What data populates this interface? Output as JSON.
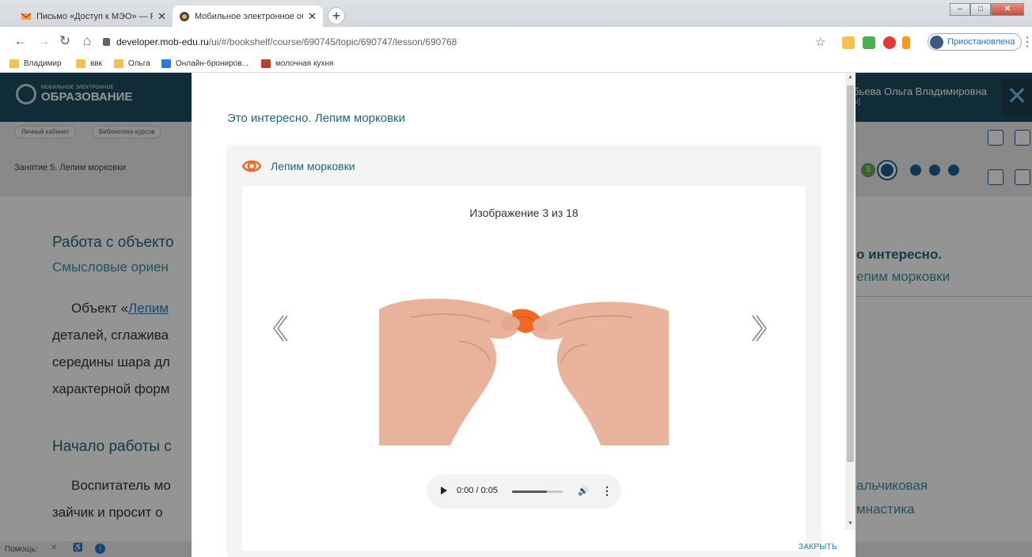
{
  "browser": {
    "tabs": [
      {
        "title": "Письмо «Доступ к МЭО» — Ро",
        "active": false
      },
      {
        "title": "Мобильное электронное обра",
        "active": true
      }
    ],
    "url_host": "developer.mob-edu.ru",
    "url_path": "/ui/#/bookshelf/course/690745/topic/690747/lesson/690768",
    "profile_label": "Приостановлена",
    "bookmarks": [
      "Владимир",
      "ввк",
      "Ольга",
      "Онлайн-брониров...",
      "молочная кухня"
    ]
  },
  "site": {
    "logo_small": "МОБИЛЬНОЕ ЭЛЕКТРОННОЕ",
    "logo_big": "ОБРАЗОВАНИЕ",
    "user_name": "бьева Ольга Владимировна",
    "user_sub": "ы]",
    "breadcrumbs": [
      "Личный кабинет",
      "Библиотека курсов"
    ],
    "lesson_title": "Занятие 5. Лепим морковки",
    "badge_number": "5",
    "content": {
      "heading1": "Работа с объекто",
      "subheading1": "Смысловые ориен",
      "para_lines": [
        "Объект «",
        "деталей, сглажива",
        "середины шара дл",
        "характерной форм"
      ],
      "para_link": "Лепим",
      "heading2": "Начало работы с",
      "para2_lines": [
        "Воспитатель мо",
        "зайчик и просит о"
      ]
    },
    "right_side": {
      "title": "о интересно.",
      "subtitle": "епим морковки",
      "item_line1": "альчиковая",
      "item_line2": "мнастика"
    },
    "help_label": "Помощь:"
  },
  "modal": {
    "title": "Это интересно. Лепим морковки",
    "panel_title": "Лепим морковки",
    "counter": "Изображение 3 из 18",
    "audio_time": "0:00 / 0:05",
    "audio_progress": 0.69,
    "close_label": "ЗАКРЫТЬ"
  },
  "colors": {
    "accent_teal": "#1d6a78",
    "orange_eye": "#f26a21",
    "link_blue": "#1a7fc4"
  }
}
